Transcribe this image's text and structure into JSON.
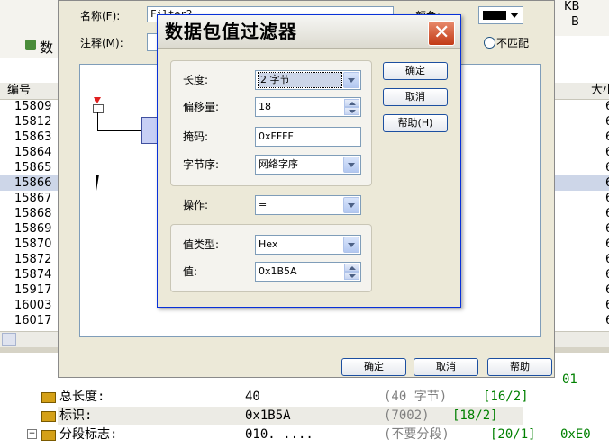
{
  "background": {
    "top_right_units": [
      "KB",
      "B"
    ],
    "packet_list": {
      "column_header": "编号",
      "rows": [
        "15809",
        "15812",
        "15863",
        "15864",
        "15865",
        "15866",
        "15867",
        "15868",
        "15869",
        "15870",
        "15872",
        "15874",
        "15917",
        "16003",
        "16017"
      ],
      "right_column_header": "大小",
      "right_value": "6"
    },
    "decode_tree": [
      {
        "label": "总长度:",
        "value": "40",
        "note": "(40 字节)",
        "extra": "[16/2]"
      },
      {
        "label": "标识:",
        "value": "0x1B5A",
        "note": "(7002)",
        "extra": "[18/2]"
      },
      {
        "label": "分段标志:",
        "value": "010. ....",
        "note": "(不要分段)",
        "extra": "[20/1]"
      }
    ],
    "decode_tree_right_values": [
      "01",
      "0xE0"
    ]
  },
  "filter_dialog": {
    "name_label": "名称(F):",
    "name_value": "Filter2",
    "comment_label": "注释(M):",
    "color_label": "颜色:",
    "no_match_label": "不匹配",
    "ok_label": "确定",
    "cancel_label": "取消",
    "help_label": "帮助"
  },
  "value_dialog": {
    "title": "数据包值过滤器",
    "length": {
      "label": "长度:",
      "value": "2 字节"
    },
    "offset": {
      "label": "偏移量:",
      "value": "18"
    },
    "mask": {
      "label": "掩码:",
      "value": "0xFFFF"
    },
    "byte_order": {
      "label": "字节序:",
      "value": "网络字序"
    },
    "operation": {
      "label": "操作:",
      "value": "="
    },
    "value_type": {
      "label": "值类型:",
      "value": "Hex"
    },
    "value": {
      "label": "值:",
      "value": "0x1B5A"
    },
    "ok_label": "确定",
    "cancel_label": "取消",
    "help_label": "帮助(H)"
  },
  "colors": {
    "accent": "#0831d9",
    "selected_row": "#cdd6e8"
  }
}
